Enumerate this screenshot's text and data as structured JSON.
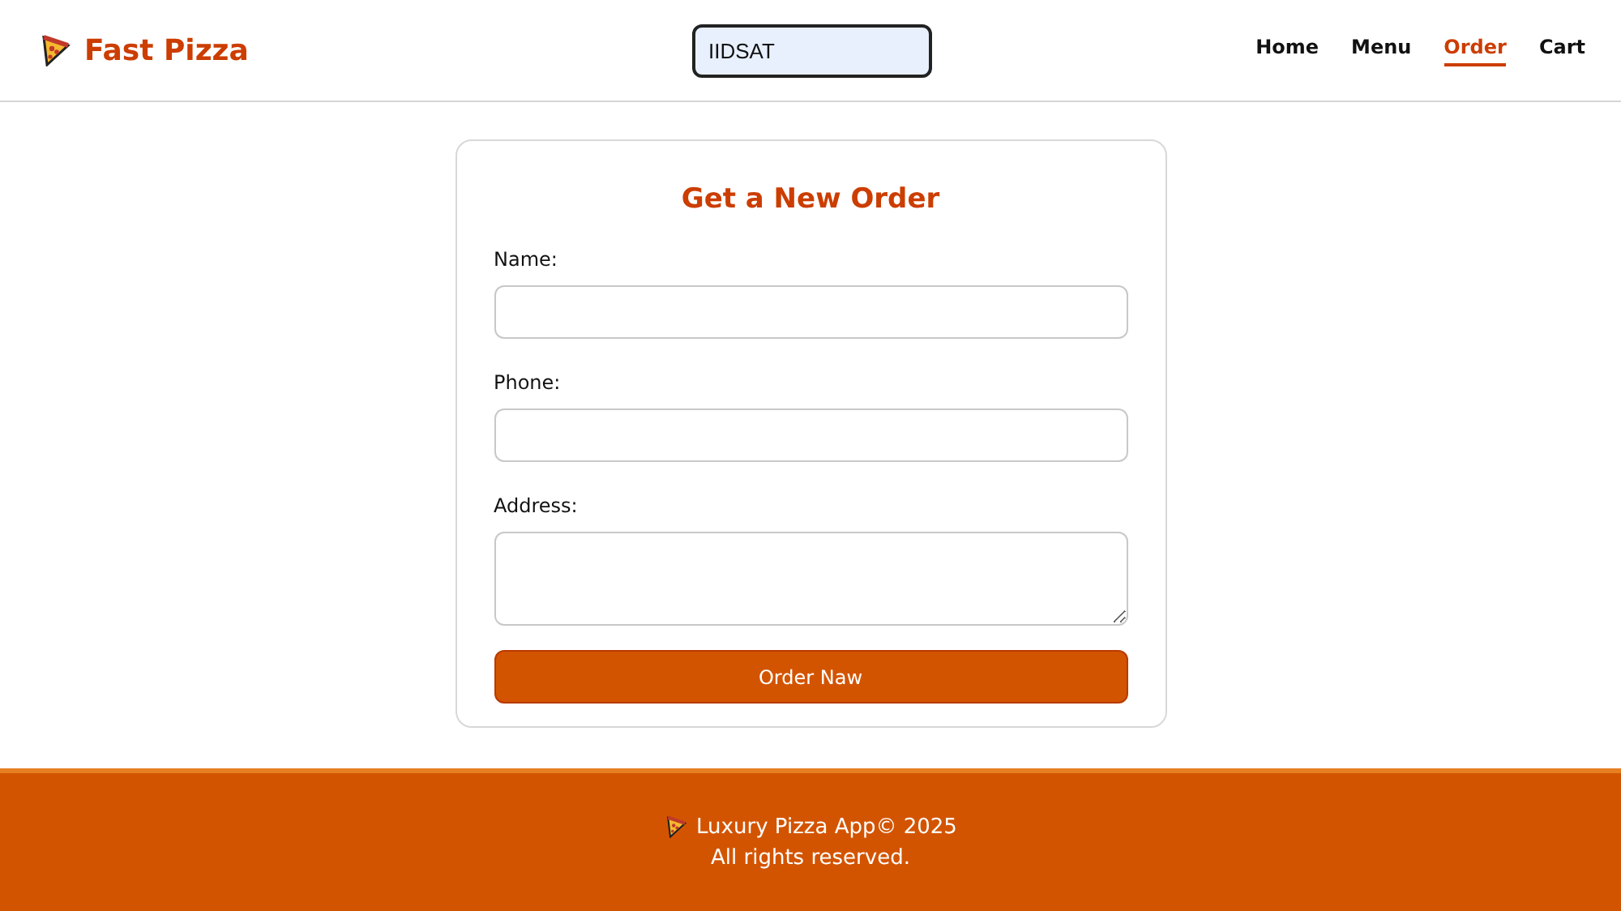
{
  "header": {
    "brand": "Fast Pizza",
    "search": {
      "value": "IIDSAT"
    },
    "nav": [
      {
        "label": "Home",
        "selected": false
      },
      {
        "label": "Menu",
        "selected": false
      },
      {
        "label": "Order",
        "selected": true
      },
      {
        "label": "Cart",
        "selected": false
      }
    ]
  },
  "form": {
    "title": "Get a New Order",
    "fields": [
      {
        "kind": "input",
        "label": "Name:"
      },
      {
        "kind": "input",
        "label": "Phone:"
      },
      {
        "kind": "textarea",
        "label": "Address:"
      }
    ],
    "submit": "Order Naw"
  },
  "footer": {
    "line1": "Luxury Pizza App© 2025",
    "line2": "All rights reserved."
  }
}
